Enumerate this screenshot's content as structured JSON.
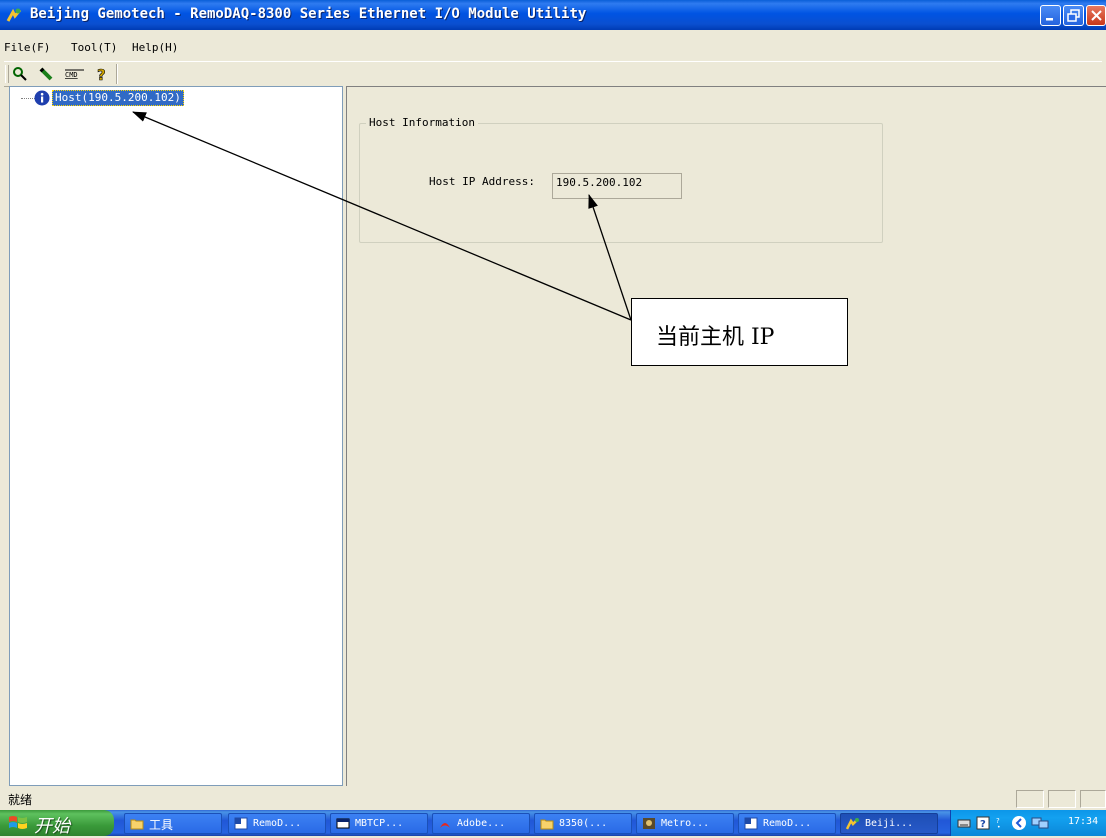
{
  "window": {
    "title": "Beijing Gemotech - RemoDAQ-8300 Series Ethernet I/O Module Utility",
    "buttons": [
      "minimize",
      "restore",
      "close"
    ]
  },
  "menu": [
    "File(F)",
    "Tool(T)",
    "Help(H)"
  ],
  "toolbar": {
    "icons": [
      "search-icon",
      "edit-icon",
      "cmd-icon",
      "help-icon"
    ]
  },
  "tree": {
    "host_label": "Host(190.5.200.102)"
  },
  "host_info": {
    "group_title": "Host Information",
    "ip_label": "Host IP Address:",
    "ip_value": "190.5.200.102"
  },
  "annotation": {
    "text": "当前主机 IP"
  },
  "status": {
    "text": "就绪"
  },
  "taskbar": {
    "start_label": "开始",
    "tasks": [
      {
        "label": "工具",
        "icon": "folder-icon"
      },
      {
        "label": "RemoD...",
        "icon": "word-icon"
      },
      {
        "label": "MBTCP...",
        "icon": "window-icon"
      },
      {
        "label": "Adobe...",
        "icon": "pdf-icon"
      },
      {
        "label": "8350(...",
        "icon": "folder-icon"
      },
      {
        "label": "Metro...",
        "icon": "app-icon"
      },
      {
        "label": "RemoD...",
        "icon": "word-icon"
      },
      {
        "label": "Beiji...",
        "icon": "gemotech-icon"
      }
    ],
    "clock": "17:34"
  },
  "colors": {
    "titlebar": "#0054e3",
    "selection": "#316ac5",
    "window_bg": "#ece9d8"
  }
}
